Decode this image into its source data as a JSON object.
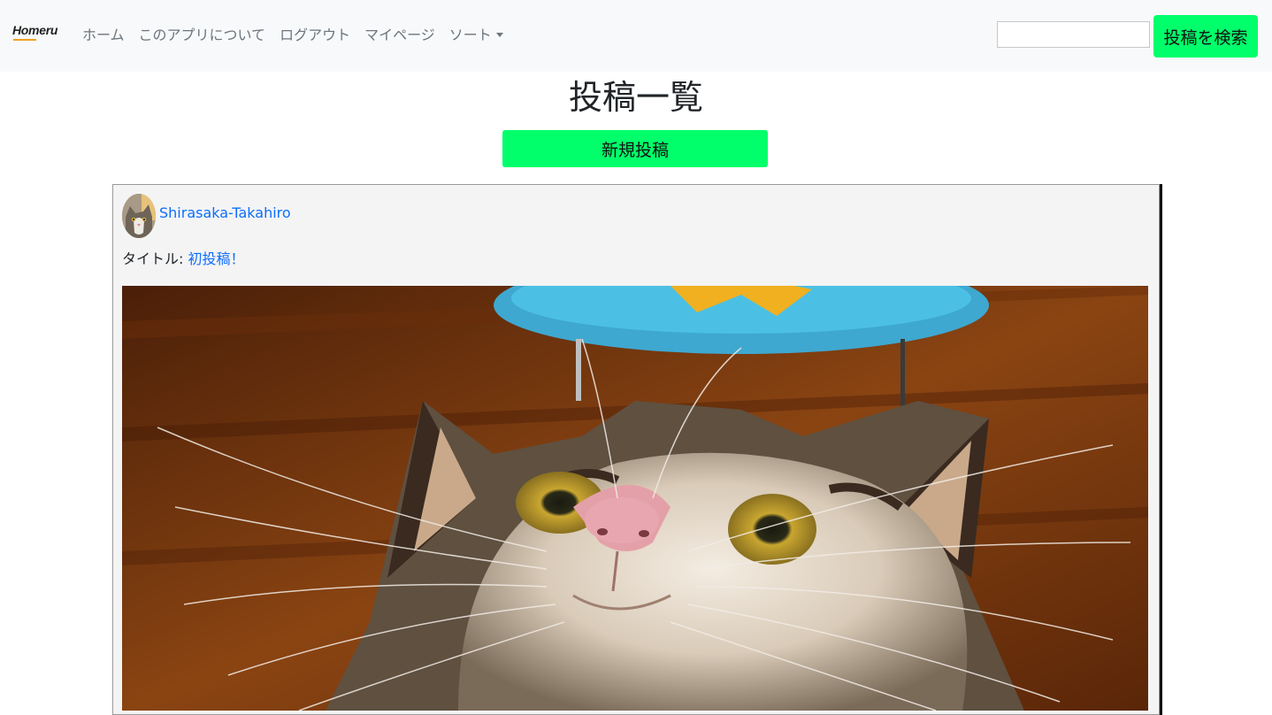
{
  "navbar": {
    "brand": "Homeru",
    "links": [
      "ホーム",
      "このアプリについて",
      "ログアウト",
      "マイページ"
    ],
    "sort_label": "ソート",
    "search_placeholder": "",
    "search_button": "投稿を検索"
  },
  "main": {
    "title": "投稿一覧",
    "new_post_button": "新規投稿"
  },
  "post": {
    "username": "Shirasaka-Takahiro",
    "title_label": "タイトル: ",
    "title": "初投稿！"
  },
  "colors": {
    "accent_green": "#00ff6a",
    "link_blue": "#0d6efd",
    "navbar_bg": "#f8f9fa"
  }
}
